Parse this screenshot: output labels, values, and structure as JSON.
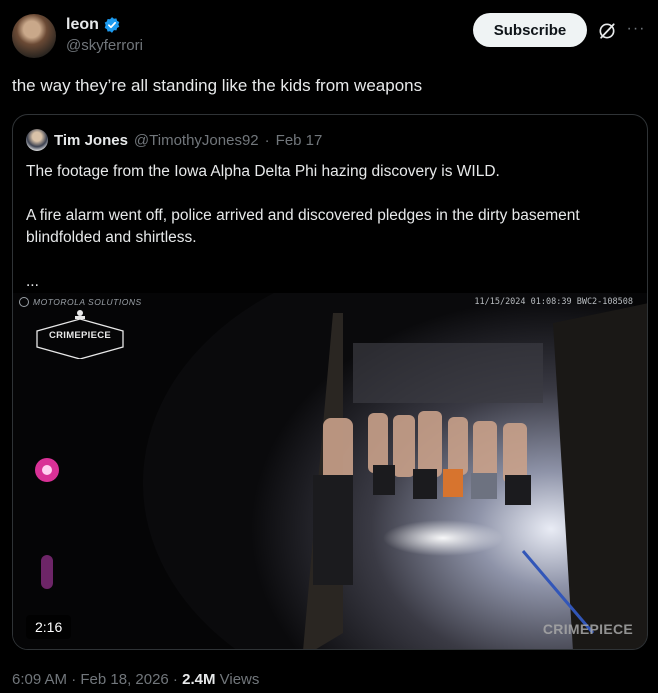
{
  "post": {
    "author_name": "leon",
    "author_handle": "@skyferrori",
    "subscribe_label": "Subscribe",
    "text": "the way they’re all standing like the kids from weapons",
    "timestamp": "6:09 AM · Feb 18, 2026 · ",
    "views_count": "2.4M",
    "views_label": "Views"
  },
  "quote": {
    "author_name": "Tim Jones",
    "author_handle": "@TimothyJones92",
    "separator": "·",
    "date": "Feb 17",
    "paragraph1": "The footage from the Iowa Alpha Delta Phi hazing discovery is WILD.",
    "paragraph2": "A fire alarm went off, police arrived and discovered pledges in the dirty basement blindfolded and shirtless.",
    "paragraph3": "..."
  },
  "video": {
    "brand": "MOTOROLA SOLUTIONS",
    "timestamp_overlay": "11/15/2024 01:08:39 BWC2-108508",
    "badge_text": "CRIMEPIECE",
    "watermark": "CRIMEPIECE",
    "duration": "2:16"
  },
  "icons": {
    "verified": "verified-badge-icon",
    "grok": "grok-icon",
    "more": "more-icon"
  },
  "colors": {
    "background": "#000000",
    "text": "#e7e9ea",
    "muted": "#71767b",
    "verified": "#1d9bf0",
    "border": "#2f3336"
  }
}
